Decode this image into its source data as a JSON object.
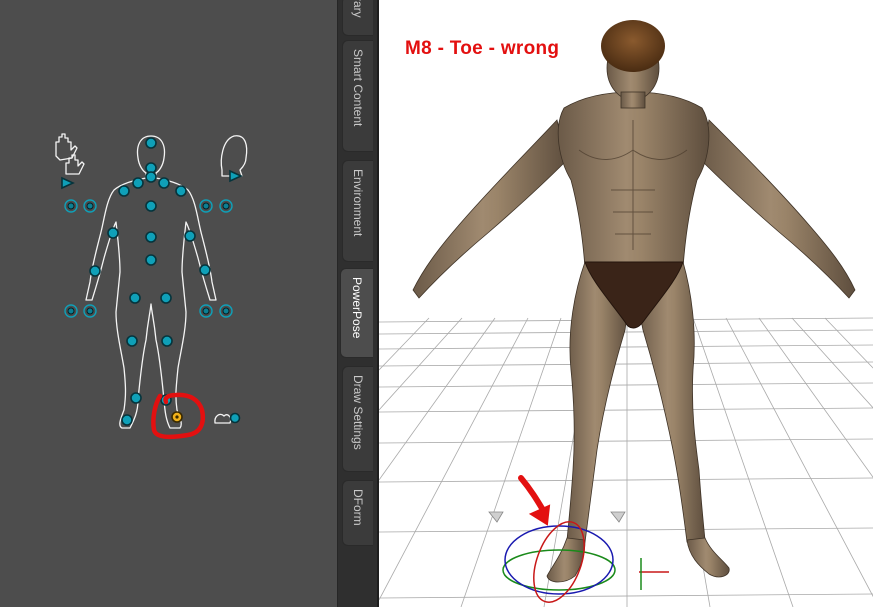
{
  "powerpose": {
    "panel_name": "PowerPose",
    "selected_node": "right-toe"
  },
  "tabs": [
    {
      "label": "Library",
      "active": false
    },
    {
      "label": "Smart Content",
      "active": false
    },
    {
      "label": "Environment",
      "active": false
    },
    {
      "label": "PowerPose",
      "active": true
    },
    {
      "label": "Draw Settings",
      "active": false
    },
    {
      "label": "DForm",
      "active": false
    }
  ],
  "viewport": {
    "annotation": "M8 - Toe - wrong",
    "annotation_color": "#e31010"
  },
  "colors": {
    "node": "#0fa0b8",
    "selected_node": "#f2b21a",
    "panel_bg": "#4d4d4d",
    "highlight_circle": "#e31010"
  }
}
